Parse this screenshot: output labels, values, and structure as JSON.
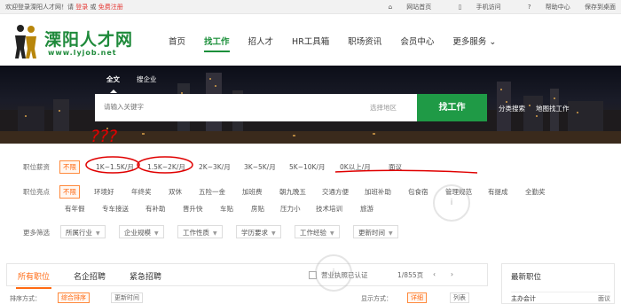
{
  "topbar": {
    "welcome": "欢迎登录溧阳人才网！请",
    "login": "登录",
    "or": "或",
    "register": "免费注册",
    "links": [
      {
        "label": "网站首页",
        "icon": "home-icon"
      },
      {
        "label": "手机访问",
        "icon": "phone-icon"
      },
      {
        "label": "帮助中心",
        "icon": "help-icon"
      },
      {
        "label": "保存到桌面",
        "icon": ""
      }
    ]
  },
  "logo": {
    "name": "溧阳人才网",
    "url": "www.lyjob.net"
  },
  "nav": [
    "首页",
    "找工作",
    "招人才",
    "HR工具箱",
    "职场资讯",
    "会员中心",
    "更多服务"
  ],
  "search": {
    "tabs": [
      "全文",
      "搜企业"
    ],
    "placeholder": "请输入关键字",
    "area_placeholder": "选择地区",
    "button": "找工作",
    "links": [
      "分类搜索",
      "地图找工作"
    ]
  },
  "filters": {
    "salary": {
      "label": "职位薪资",
      "options": [
        "不限",
        "1K~1.5K/月",
        "1.5K~2K/月",
        "2K~3K/月",
        "3K~5K/月",
        "5K~10K/月",
        "0K以上/月",
        "面议"
      ]
    },
    "highlights": {
      "label": "职位亮点",
      "row1": [
        "不限",
        "环境好",
        "年终奖",
        "双休",
        "五险一金",
        "加班费",
        "朝九晚五",
        "交通方便",
        "加班补助",
        "包食宿",
        "管理规范",
        "有提成",
        "全勤奖"
      ],
      "row2": [
        "有年假",
        "专车接送",
        "有补助",
        "晋升快",
        "车贴",
        "房贴",
        "压力小",
        "技术培训",
        "旅游"
      ]
    },
    "more": {
      "label": "更多筛选",
      "dropdowns": [
        "所属行业",
        "企业规模",
        "工作性质",
        "学历要求",
        "工作经验",
        "更新时间"
      ]
    }
  },
  "annotation": {
    "marks": "???"
  },
  "job_tabs": [
    "所有职位",
    "名企招聘",
    "紧急招聘"
  ],
  "toolbar": {
    "filter_label": "营业执照已认证",
    "page_info": "1/855页"
  },
  "sort": {
    "label": "排序方式：",
    "options": [
      "综合排序",
      "更新时间"
    ],
    "display_label": "显示方式：",
    "detail": "详细",
    "list": "列表"
  },
  "sidebar": {
    "title": "最新职位",
    "items": [
      {
        "job": "主办会计",
        "pay": "面议"
      }
    ]
  },
  "colors": {
    "brand": "#1f9a46",
    "accent": "#ff6a13",
    "annotation": "#e00000"
  }
}
